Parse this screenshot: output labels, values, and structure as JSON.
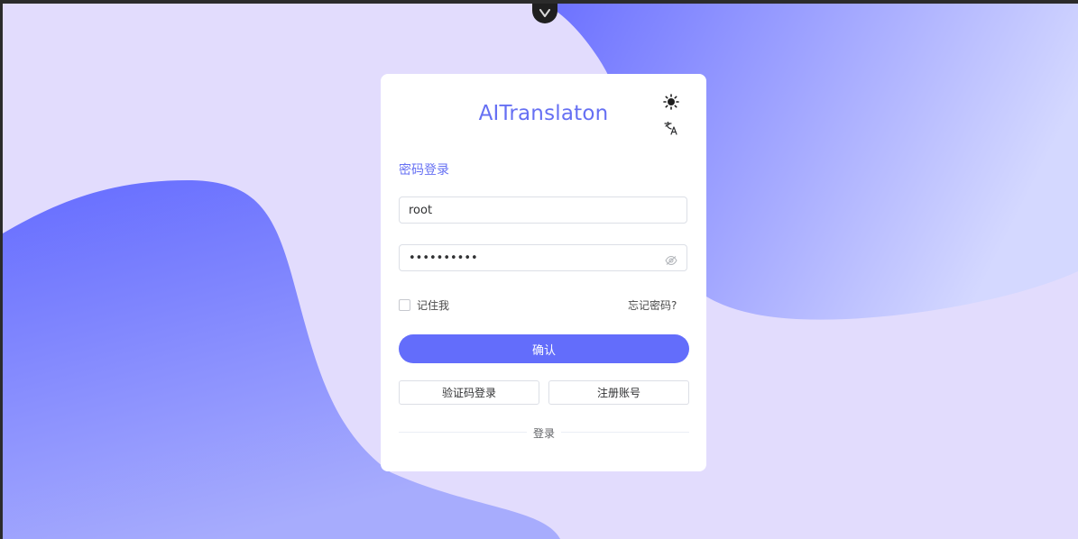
{
  "app": {
    "title": "AITranslaton"
  },
  "header": {
    "theme_icon": "sun-icon",
    "language_icon": "translate-icon"
  },
  "login": {
    "subtitle": "密码登录",
    "username": {
      "value": "root",
      "placeholder": ""
    },
    "password": {
      "value": "••••••••••",
      "masked_value": "••••••••••",
      "icon": "eye-icon"
    },
    "remember_label": "记住我",
    "remember_checked": false,
    "forgot_label": "忘记密码?",
    "confirm_label": "确认",
    "code_login_label": "验证码登录",
    "register_label": "注册账号",
    "divider_label": "登录"
  },
  "colors": {
    "accent": "#636dfb",
    "background": "#e2dcfd",
    "card": "#ffffff"
  }
}
